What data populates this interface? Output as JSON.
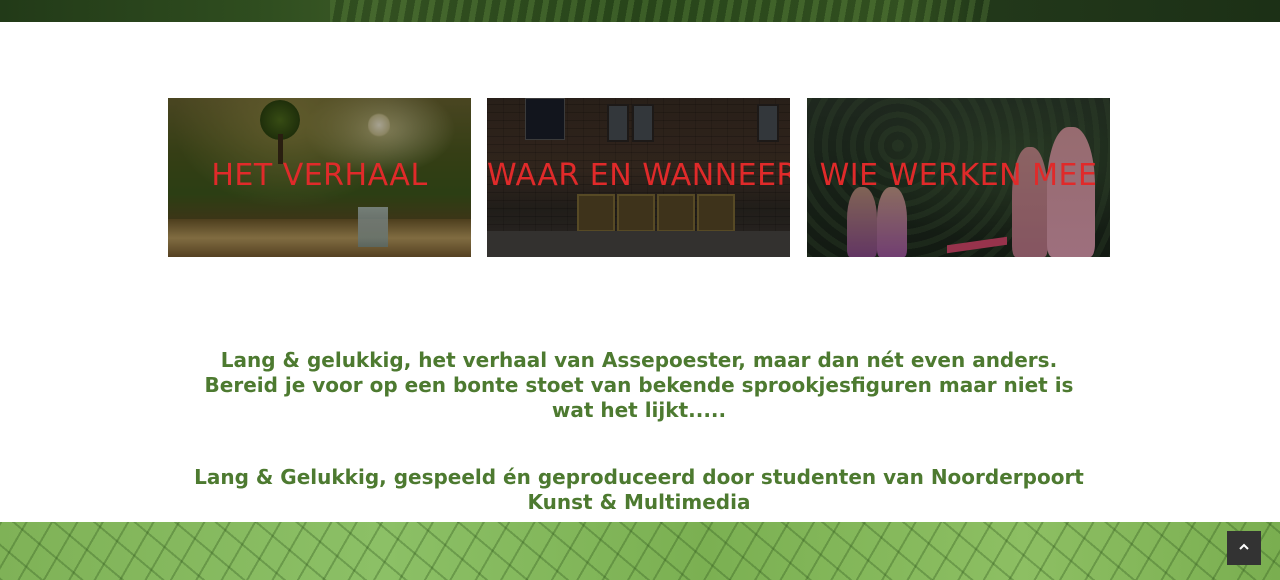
{
  "tiles": [
    {
      "title": "HET VERHAAL"
    },
    {
      "title": "WAAR EN WANNEER"
    },
    {
      "title": "WIE WERKEN MEE"
    }
  ],
  "intro_text": "Lang & gelukkig, het verhaal van Assepoester, maar dan nét even anders. Bereid je voor op een bonte stoet van bekende sprookjesfiguren maar niet is wat het lijkt.....",
  "credits_text": "Lang & Gelukkig, gespeeld én geproduceerd door studenten van Noorderpoort Kunst & Multimedia",
  "colors": {
    "tile_title": "#e02a2a",
    "body_text": "#4d7a30",
    "scroll_top_bg": "#333333"
  },
  "icons": {
    "scroll_top": "chevron-up-icon"
  }
}
